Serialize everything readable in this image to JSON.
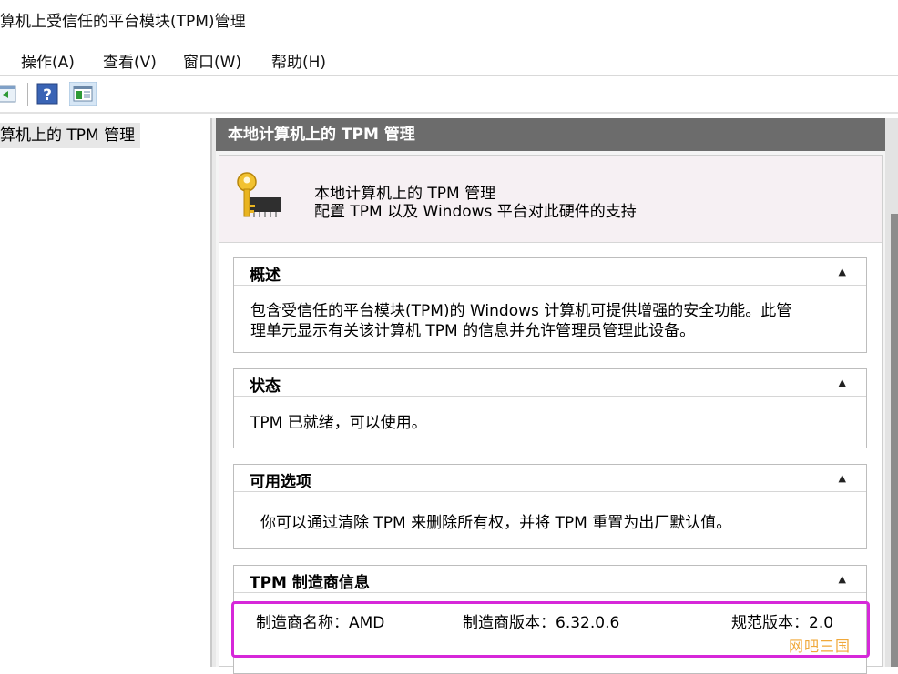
{
  "window": {
    "title": "算机上受信任的平台模块(TPM)管理"
  },
  "menu": [
    {
      "label": "操作(A)"
    },
    {
      "label": "查看(V)"
    },
    {
      "label": "窗口(W)"
    },
    {
      "label": "帮助(H)"
    }
  ],
  "toolbar": {
    "icons": [
      "back-icon",
      "help-icon",
      "show-pane-icon"
    ]
  },
  "tree": {
    "selected_item": "算机上的 TPM 管理"
  },
  "content": {
    "header": "本地计算机上的 TPM 管理",
    "banner": {
      "icon": "key-chip-icon",
      "title": "本地计算机上的 TPM 管理",
      "subtitle": "配置 TPM 以及 Windows 平台对此硬件的支持"
    },
    "sections": {
      "overview": {
        "title": "概述",
        "lines": [
          "包含受信任的平台模块(TPM)的 Windows 计算机可提供增强的安全功能。此管",
          "理单元显示有关该计算机 TPM 的信息并允许管理员管理此设备。"
        ]
      },
      "status": {
        "title": "状态",
        "text": "TPM 已就绪，可以使用。"
      },
      "options": {
        "title": "可用选项",
        "text": "你可以通过清除 TPM 来删除所有权，并将 TPM 重置为出厂默认值。"
      },
      "manufacturer": {
        "title": "TPM 制造商信息",
        "name": "制造商名称：AMD",
        "version": "制造商版本：6.32.0.6",
        "spec": "规范版本：2.0"
      }
    }
  },
  "watermark": "网吧三国",
  "colors": {
    "header_bg": "#6c6c6c",
    "highlight": "#d628d9",
    "watermark": "#f0a83a"
  }
}
